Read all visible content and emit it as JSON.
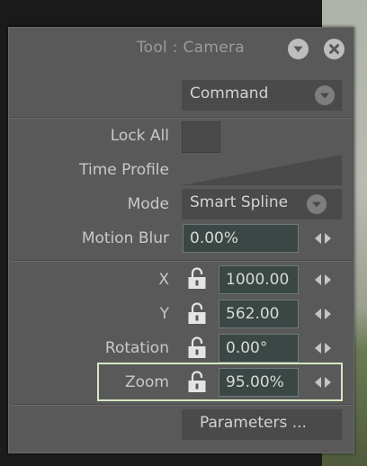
{
  "panel": {
    "title": "Tool : Camera",
    "icons": {
      "minimize": "chevron-down-circle-icon",
      "close": "close-circle-icon"
    }
  },
  "command_dropdown": {
    "value": "Command"
  },
  "lock_all": {
    "label": "Lock All",
    "checked": false
  },
  "time_profile": {
    "label": "Time Profile"
  },
  "mode": {
    "label": "Mode",
    "value": "Smart Spline"
  },
  "motion_blur": {
    "label": "Motion Blur",
    "value": "0.00%"
  },
  "params": [
    {
      "key": "x",
      "label": "X",
      "value": "1000.00",
      "locked": false
    },
    {
      "key": "y",
      "label": "Y",
      "value": "562.00",
      "locked": false
    },
    {
      "key": "rotation",
      "label": "Rotation",
      "value": "0.00°",
      "locked": false
    },
    {
      "key": "zoom",
      "label": "Zoom",
      "value": "95.00%",
      "locked": false,
      "highlighted": true
    }
  ],
  "parameters_button": {
    "label": "Parameters ..."
  },
  "colors": {
    "panel_bg": "#595959",
    "field_bg": "#3a4744",
    "highlight": "#d5e8c1",
    "text": "#c9c9c9"
  }
}
